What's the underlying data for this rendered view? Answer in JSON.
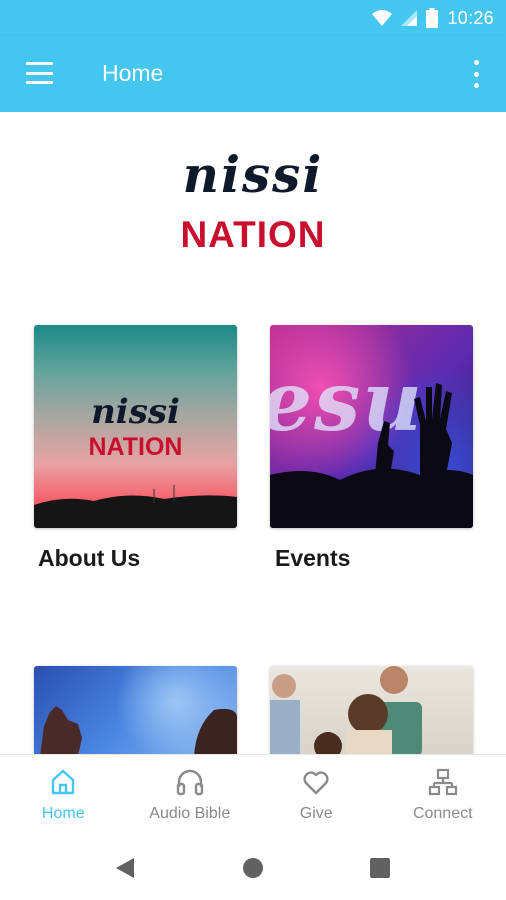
{
  "status_bar": {
    "time": "10:26",
    "icons": [
      "wifi-icon",
      "signal-icon",
      "battery-icon"
    ]
  },
  "app_bar": {
    "title": "Home",
    "menu_icon": "hamburger-menu-icon",
    "overflow_icon": "more-vert-icon"
  },
  "header_logo": {
    "script": "nissi",
    "word": "NATION"
  },
  "tiles": [
    {
      "label": "About Us",
      "logo_script": "nissi",
      "logo_word": "NATION"
    },
    {
      "label": "Events",
      "image_text": "esu"
    },
    {
      "label": ""
    },
    {
      "label": ""
    }
  ],
  "bottom_nav": {
    "items": [
      {
        "label": "Home",
        "icon": "home-icon",
        "active": true
      },
      {
        "label": "Audio Bible",
        "icon": "headphones-icon",
        "active": false
      },
      {
        "label": "Give",
        "icon": "heart-icon",
        "active": false
      },
      {
        "label": "Connect",
        "icon": "network-icon",
        "active": false
      }
    ]
  },
  "colors": {
    "primary": "#45c6ee",
    "logo_red": "#c8102e",
    "logo_navy": "#0e1a2b",
    "nav_inactive": "#8a8a8a"
  },
  "system_nav": [
    "back-icon",
    "home-circle-icon",
    "recents-icon"
  ]
}
